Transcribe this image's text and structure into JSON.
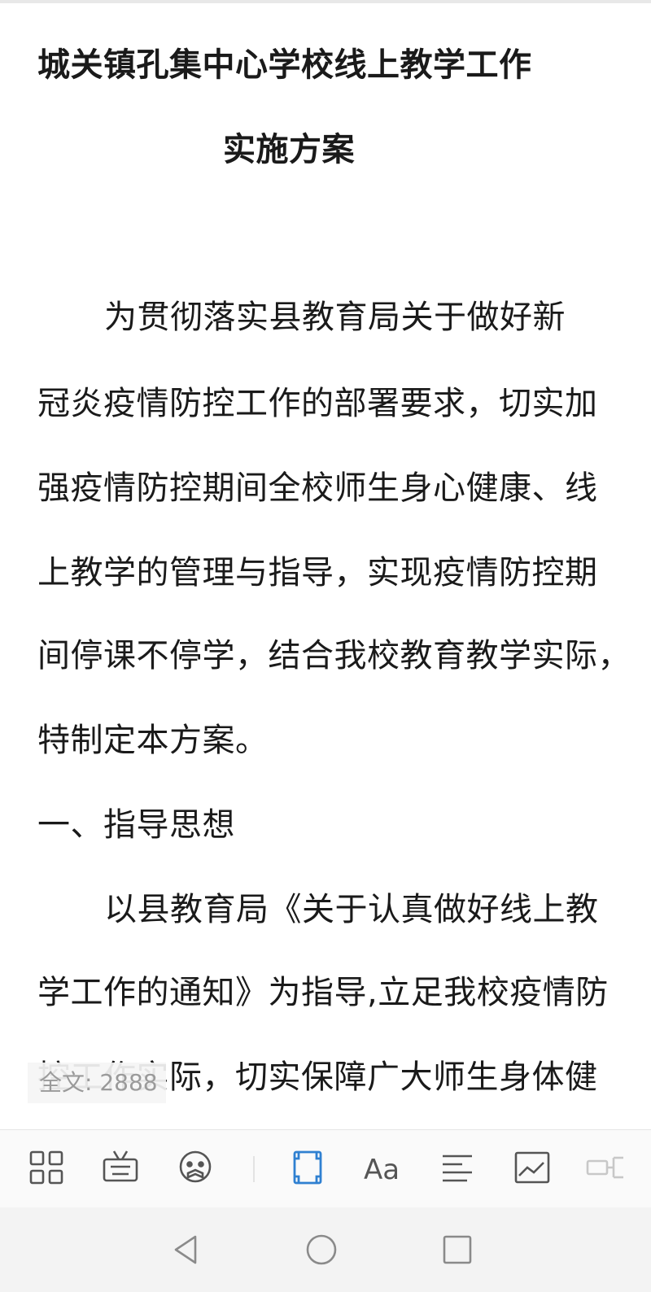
{
  "document": {
    "title_line1": "城关镇孔集中心学校线上教学工作",
    "title_line2": "实施方案",
    "lines": [
      "为贯彻落实县教育局关于做好新",
      "冠炎疫情防控工作的部署要求，切实加",
      "强疫情防控期间全校师生身心健康、线",
      "上教学的管理与指导，实现疫情防控期",
      "间停课不停学，结合我校教育教学实际，",
      "特制定本方案。",
      "一、指导思想",
      "以县教育局《关于认真做好线上教",
      "学工作的通知》为指导,立足我校疫情防",
      "控工作实际，切实保障广大师生身体健"
    ]
  },
  "word_count": "全文: 2888",
  "toolbar": {
    "icons": [
      "grid-icon",
      "keyboard-icon",
      "voice-assistant-icon",
      "fullscreen-icon",
      "font-icon",
      "align-icon",
      "image-icon",
      "mindmap-icon"
    ],
    "active": "fullscreen-icon",
    "font_glyph": "Aa"
  },
  "nav": {
    "icons": [
      "back-icon",
      "home-icon",
      "recents-icon"
    ]
  },
  "colors": {
    "accent": "#2f80d1",
    "icon": "#555555",
    "text": "#1a1a1a"
  }
}
